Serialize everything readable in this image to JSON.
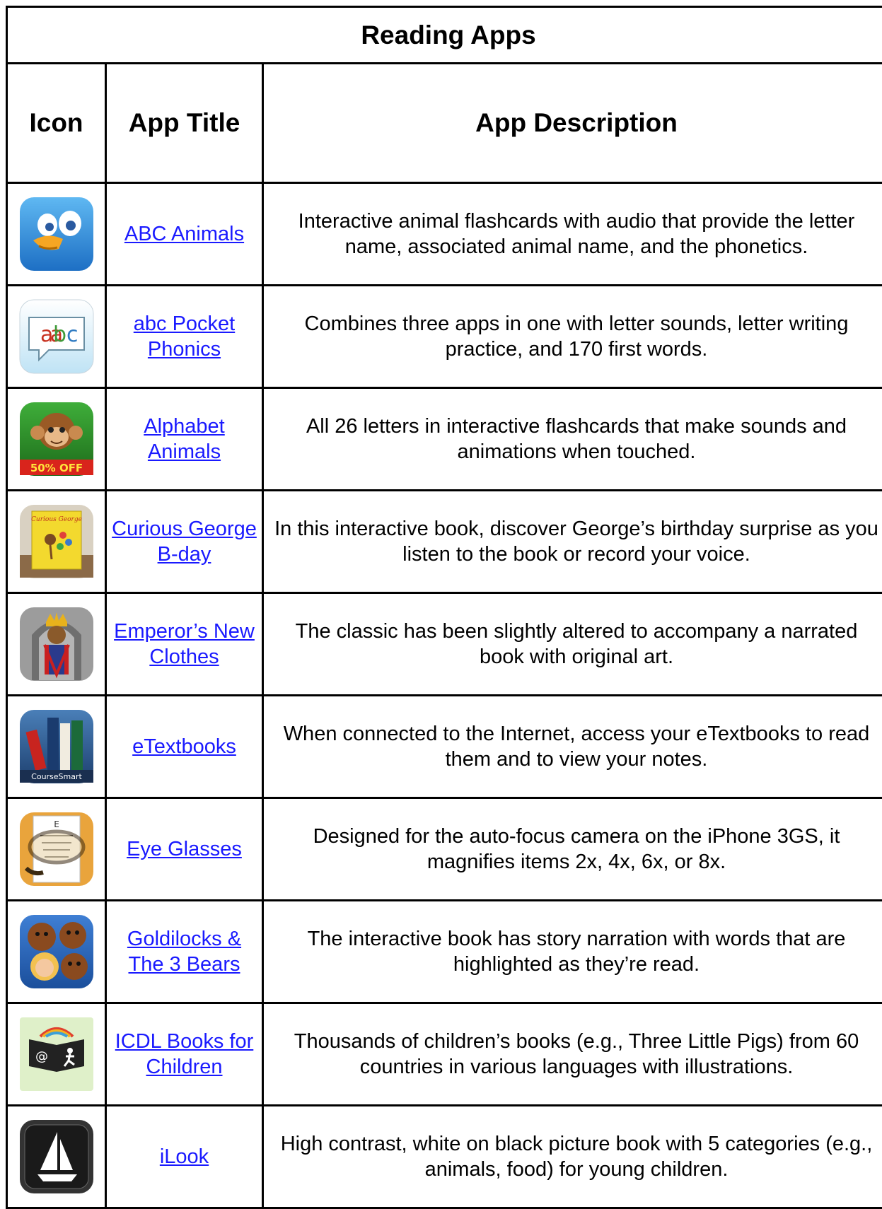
{
  "table": {
    "title": "Reading Apps",
    "headers": {
      "icon": "Icon",
      "app_title": "App Title",
      "app_description": "App Description"
    },
    "rows": [
      {
        "icon": "bird-cartoon-icon",
        "title": "ABC Animals",
        "description": "Interactive animal flashcards with audio that provide the letter name, associated animal name, and the phonetics."
      },
      {
        "icon": "speech-bubble-abc-icon",
        "title": "abc Pocket Phonics",
        "description": "Combines three apps in one with letter sounds, letter writing practice, and 170 first words."
      },
      {
        "icon": "monkey-icon",
        "title": "Alphabet Animals",
        "description": "All 26 letters in interactive flashcards that make sounds and animations when touched.",
        "icon_badge": "50% OFF"
      },
      {
        "icon": "curious-george-book-icon",
        "title": "Curious George B-day",
        "description": "In this interactive book, discover George’s birthday surprise as you listen to the book or record your voice."
      },
      {
        "icon": "emperor-icon",
        "title": "Emperor’s New Clothes",
        "description": "The classic has been slightly altered to accompany a narrated book with original art."
      },
      {
        "icon": "books-icon",
        "title": "eTextbooks",
        "description": "When connected to the Internet, access your eTextbooks to read them and to view your notes.",
        "icon_badge": "CourseSmart"
      },
      {
        "icon": "eye-chart-glasses-icon",
        "title": "Eye Glasses",
        "description": "Designed for the auto-focus camera on the iPhone 3GS, it magnifies items 2x, 4x, 6x, or 8x."
      },
      {
        "icon": "bears-girl-icon",
        "title": "Goldilocks & The 3 Bears",
        "description": "The interactive book has story narration with words that are highlighted as they’re read."
      },
      {
        "icon": "icdl-book-icon",
        "title": "ICDL Books for Children",
        "description": "Thousands of children’s books (e.g., Three Little Pigs) from 60 countries in various languages with illustrations."
      },
      {
        "icon": "sailboat-icon",
        "title": "iLook",
        "description": "High contrast, white on black picture book with 5 categories (e.g., animals, food) for young children."
      }
    ]
  },
  "colors": {
    "link": "#1a1aff",
    "border": "#000000"
  }
}
